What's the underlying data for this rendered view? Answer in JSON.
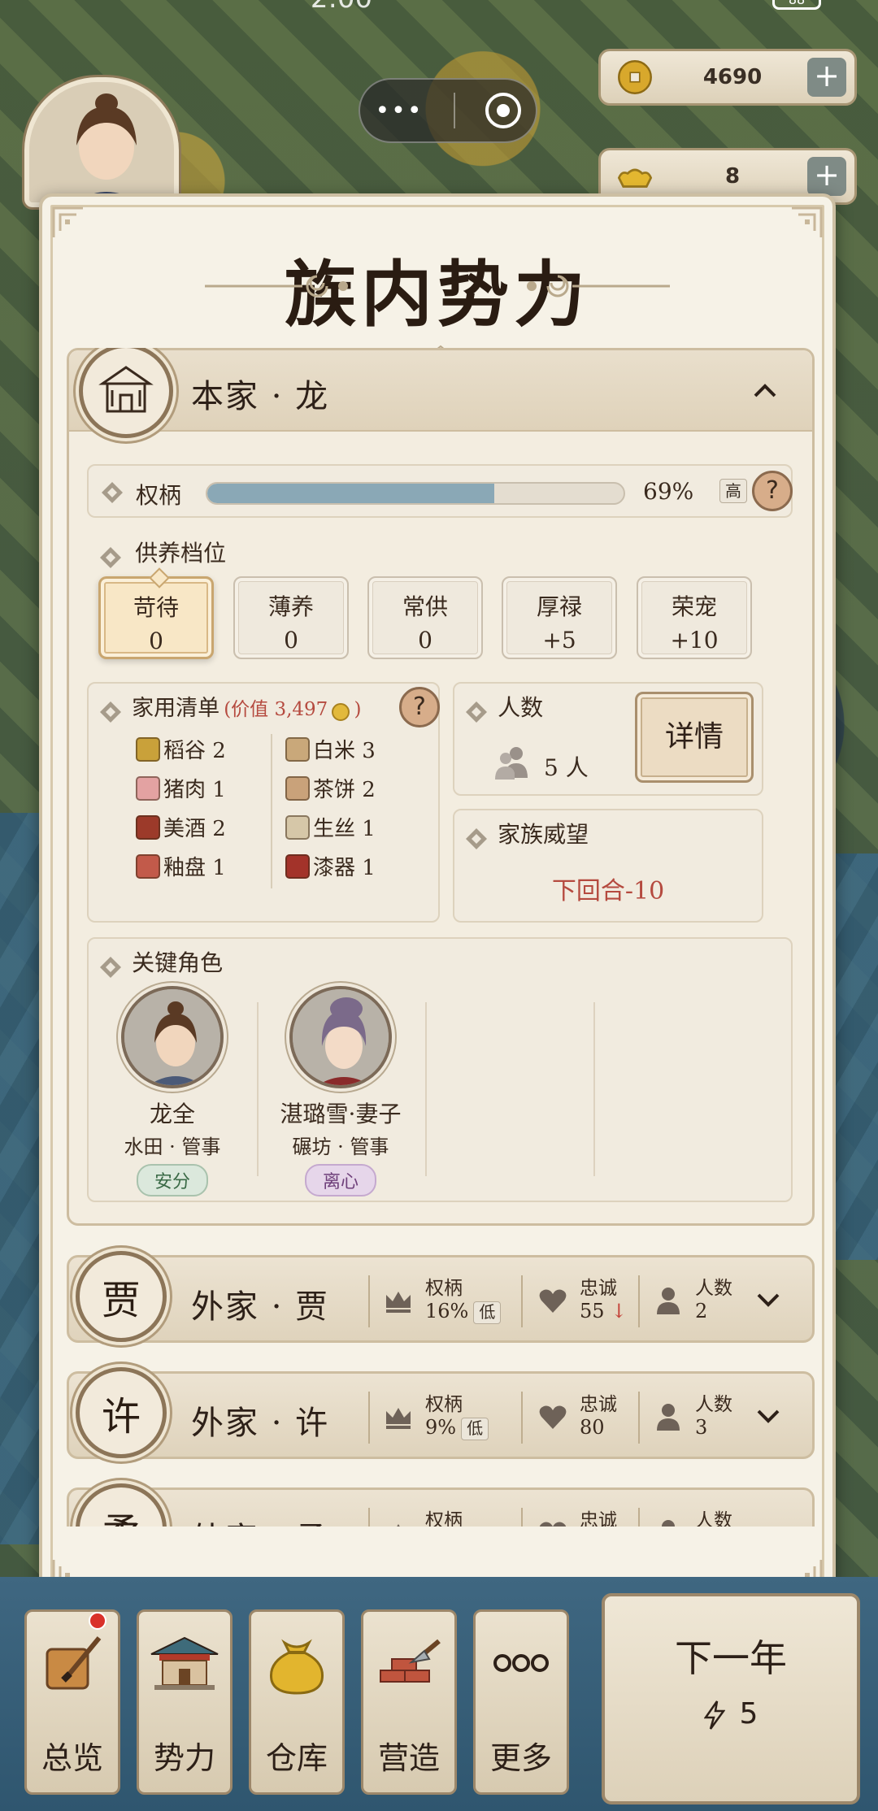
{
  "status": {
    "time": "2:00",
    "battery": "88"
  },
  "resources": [
    {
      "icon": "copper-coin-icon",
      "value": "4690"
    },
    {
      "icon": "gold-ingot-icon",
      "value": "8"
    }
  ],
  "capsule": {
    "more": "•••"
  },
  "panel": {
    "title": "族内势力",
    "main_clan": {
      "name": "本家 · 龙",
      "authority": {
        "label": "权柄",
        "percent": 69,
        "percent_text": "69%",
        "level": "高",
        "help": "?"
      },
      "support": {
        "label": "供养档位",
        "tiers": [
          {
            "name": "苛待",
            "value": "0",
            "active": true
          },
          {
            "name": "薄养",
            "value": "0"
          },
          {
            "name": "常供",
            "value": "0"
          },
          {
            "name": "厚禄",
            "value": "+5"
          },
          {
            "name": "荣宠",
            "value": "+10"
          }
        ]
      },
      "household": {
        "label": "家用清单",
        "worth_prefix": "(价值 3,497",
        "worth_suffix": ")",
        "help": "?",
        "items": [
          {
            "name": "稻谷 2",
            "color": "#c9a13a"
          },
          {
            "name": "白米 3",
            "color": "#c9a87a"
          },
          {
            "name": "猪肉 1",
            "color": "#e3a2a2"
          },
          {
            "name": "茶饼 2",
            "color": "#c9a27a"
          },
          {
            "name": "美酒 2",
            "color": "#9c3a2a"
          },
          {
            "name": "生丝 1",
            "color": "#d6c7a8"
          },
          {
            "name": "釉盘 1",
            "color": "#c25a4a"
          },
          {
            "name": "漆器 1",
            "color": "#a3332a"
          }
        ]
      },
      "headcount": {
        "label": "人数",
        "count": "5 人",
        "detail_button": "详情"
      },
      "prestige": {
        "label": "家族威望",
        "next_round": "下回合-10"
      },
      "key_roles": {
        "label": "关键角色",
        "roles": [
          {
            "name": "龙全",
            "job": "水田 · 管事",
            "status": "安分"
          },
          {
            "name": "湛璐雪·妻子",
            "job": "碾坊 · 管事",
            "status": "离心"
          }
        ]
      }
    },
    "outer_clans": [
      {
        "emblem": "贾",
        "name": "外家 · 贾",
        "authority_label": "权柄",
        "authority": "16%",
        "authority_level": "低",
        "loyalty_label": "忠诚",
        "loyalty": "55",
        "loyalty_trend": "↓",
        "people_label": "人数",
        "people": "2"
      },
      {
        "emblem": "许",
        "name": "外家 · 许",
        "authority_label": "权柄",
        "authority": "9%",
        "authority_level": "低",
        "loyalty_label": "忠诚",
        "loyalty": "80",
        "loyalty_trend": "",
        "people_label": "人数",
        "people": "3"
      },
      {
        "emblem": "柔",
        "name": "外家 · 柔",
        "authority_label": "权柄",
        "authority": "",
        "authority_level": "",
        "loyalty_label": "忠诚",
        "loyalty": "",
        "loyalty_trend": "",
        "people_label": "人数",
        "people": ""
      }
    ]
  },
  "bottom_nav": [
    {
      "label": "总览",
      "icon": "scroll-brush-icon",
      "badge": true
    },
    {
      "label": "势力",
      "icon": "palace-icon"
    },
    {
      "label": "仓库",
      "icon": "money-bag-icon"
    },
    {
      "label": "营造",
      "icon": "bricks-trowel-icon"
    },
    {
      "label": "更多",
      "icon": "more-dots-icon"
    }
  ],
  "next_year": {
    "label": "下一年",
    "cost": "5"
  }
}
